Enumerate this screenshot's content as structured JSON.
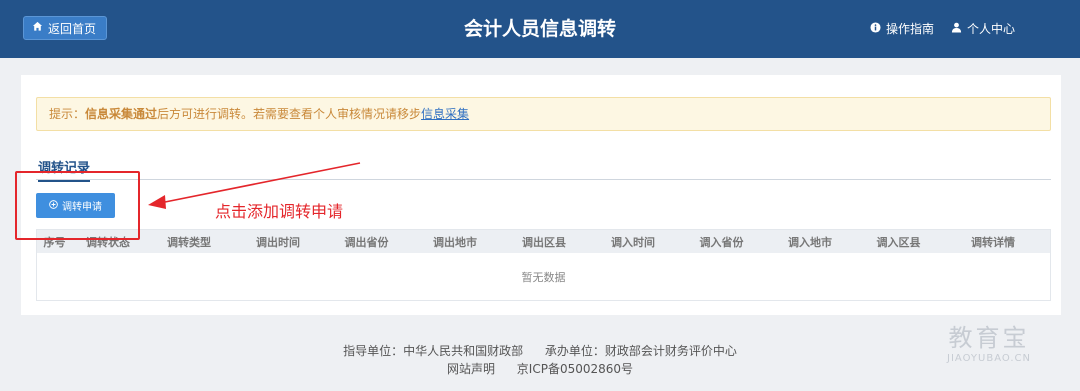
{
  "header": {
    "home_label": "返回首页",
    "title": "会计人员信息调转",
    "guide_label": "操作指南",
    "user_label": "个人中心"
  },
  "notice": {
    "prefix": "提示：",
    "strong": "信息采集通过",
    "middle": "后方可进行调转。若需要查看个人审核情况请移步",
    "link": "信息采集"
  },
  "tabs": [
    {
      "label": "调转记录",
      "active": true
    }
  ],
  "actions": {
    "apply_label": "调转申请"
  },
  "table": {
    "columns": [
      "序号",
      "调转状态",
      "调转类型",
      "调出时间",
      "调出省份",
      "调出地市",
      "调出区县",
      "调入时间",
      "调入省份",
      "调入地市",
      "调入区县",
      "调转详情"
    ],
    "empty_text": "暂无数据"
  },
  "annotation": {
    "text": "点击添加调转申请",
    "color": "#e4262b"
  },
  "footer": {
    "guide_unit": "指导单位：中华人民共和国财政部",
    "host_unit": "承办单位：财政部会计财务评价中心",
    "statement": "网站声明",
    "icp": "京ICP备05002860号"
  },
  "watermark": {
    "cn": "教育宝",
    "en": "JIAOYUBAO.CN"
  },
  "colors": {
    "header_bg": "#23538a",
    "primary": "#3f8fdf",
    "notice_bg": "#fdf7e3",
    "notice_text": "#c9893a",
    "link": "#2f6fc1"
  }
}
